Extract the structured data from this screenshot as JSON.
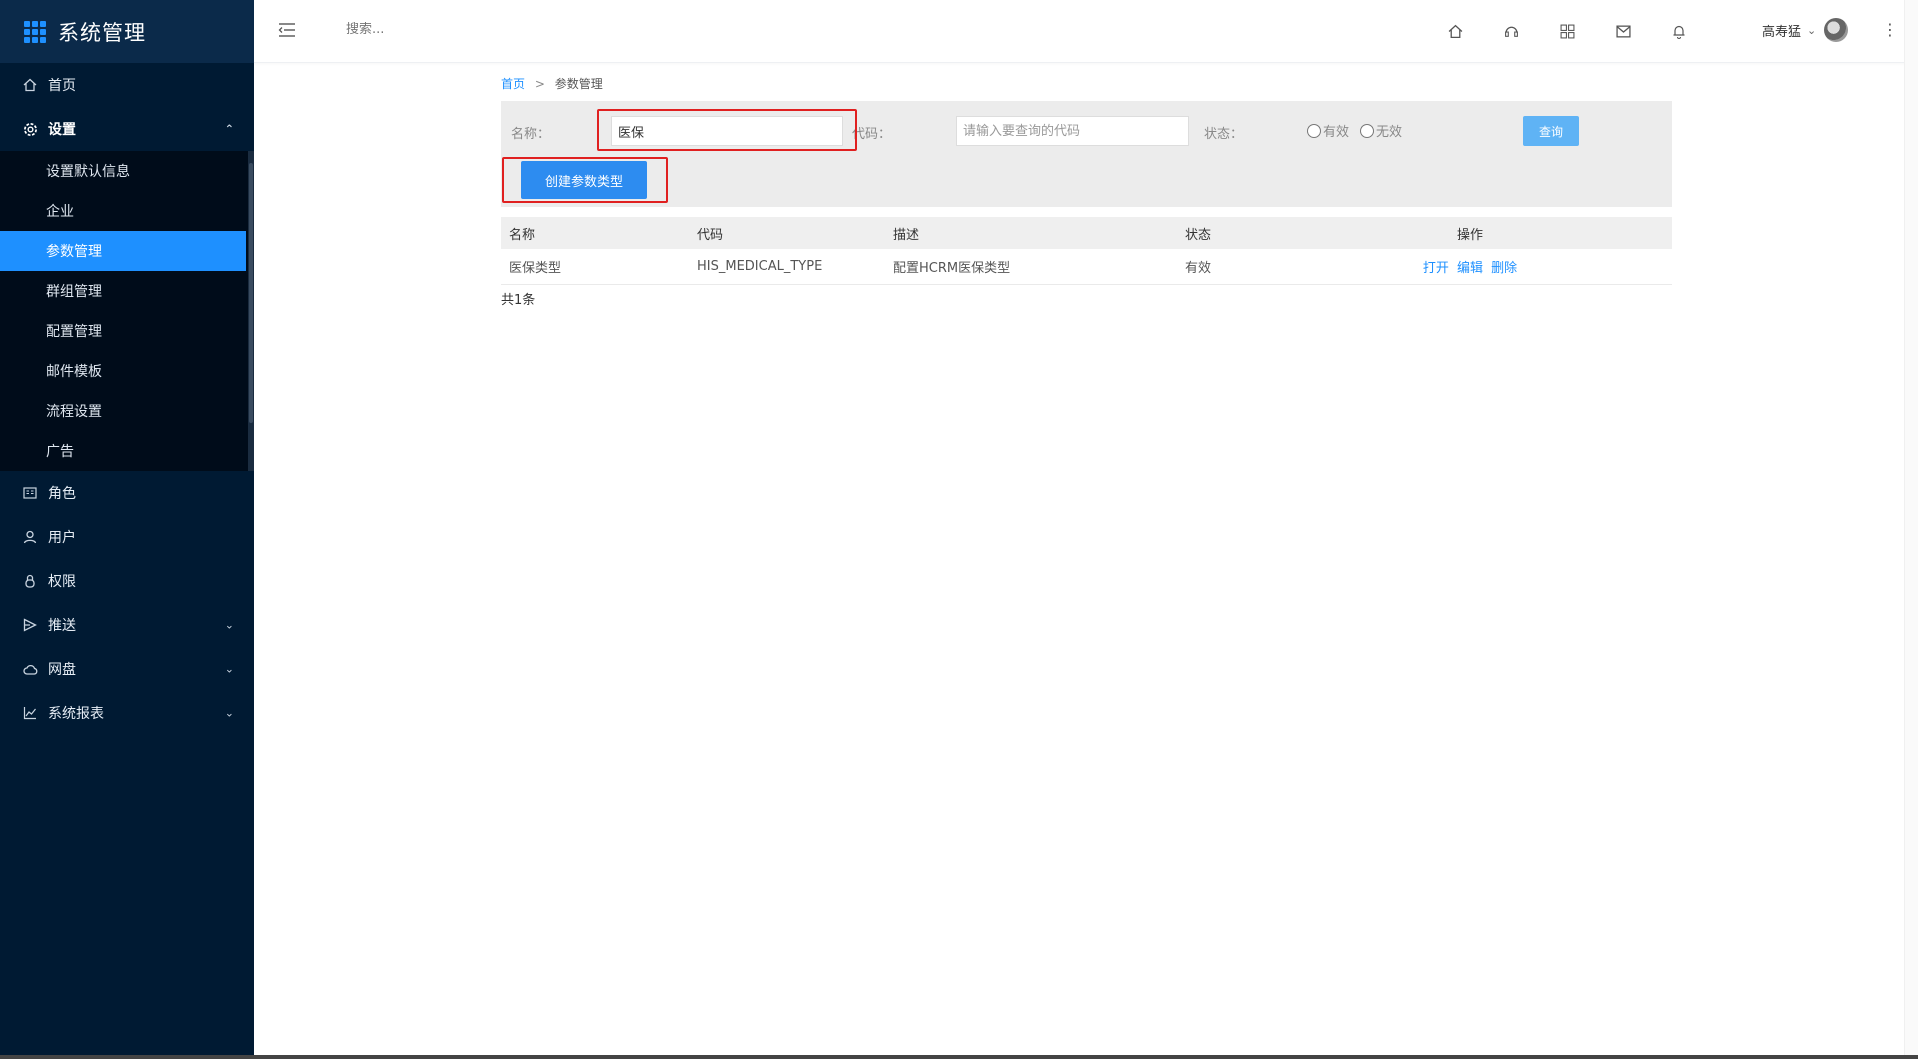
{
  "app": {
    "title": "系统管理"
  },
  "sidebar": {
    "items": [
      {
        "label": "首页",
        "icon": "home-icon"
      },
      {
        "label": "设置",
        "icon": "gear-icon",
        "expanded": true,
        "children": [
          {
            "label": "设置默认信息"
          },
          {
            "label": "企业"
          },
          {
            "label": "参数管理",
            "active": true
          },
          {
            "label": "群组管理"
          },
          {
            "label": "配置管理"
          },
          {
            "label": "邮件模板"
          },
          {
            "label": "流程设置"
          },
          {
            "label": "广告"
          }
        ]
      },
      {
        "label": "角色",
        "icon": "role-icon"
      },
      {
        "label": "用户",
        "icon": "user-icon"
      },
      {
        "label": "权限",
        "icon": "lock-icon"
      },
      {
        "label": "推送",
        "icon": "send-icon",
        "collapsible": true
      },
      {
        "label": "网盘",
        "icon": "cloud-icon",
        "collapsible": true
      },
      {
        "label": "系统报表",
        "icon": "chart-icon",
        "collapsible": true
      }
    ]
  },
  "header": {
    "search_placeholder": "搜索...",
    "icons": [
      "home-icon",
      "headset-icon",
      "apps-icon",
      "mail-icon",
      "bell-icon"
    ],
    "user_name": "高寿猛"
  },
  "breadcrumb": {
    "home": "首页",
    "separator": ">",
    "current": "参数管理"
  },
  "filter": {
    "name_label": "名称：",
    "name_value": "医保",
    "code_label": "代码：",
    "code_placeholder": "请输入要查询的代码",
    "status_label": "状态：",
    "status_options": [
      "有效",
      "无效"
    ],
    "query_button": "查询",
    "create_button": "创建参数类型"
  },
  "table": {
    "columns": [
      "名称",
      "代码",
      "描述",
      "状态",
      "操作"
    ],
    "rows": [
      {
        "name": "医保类型",
        "code": "HIS_MEDICAL_TYPE",
        "desc": "配置HCRM医保类型",
        "status": "有效",
        "ops": [
          "打开",
          "编辑",
          "删除"
        ]
      }
    ],
    "total": "共1条"
  },
  "colors": {
    "sidebar_bg": "#001a33",
    "accent": "#1e90ff",
    "highlight": "#e02020"
  }
}
